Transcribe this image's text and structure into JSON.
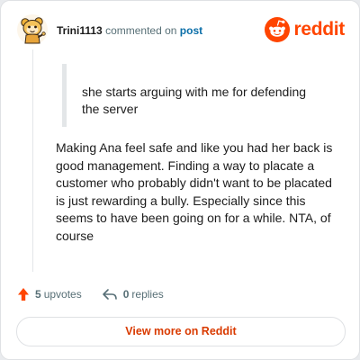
{
  "header": {
    "username": "Trini1113",
    "action_text": "commented on",
    "post_link": "post",
    "brand_name": "reddit"
  },
  "comment": {
    "quote": "she starts arguing with me for defending the server",
    "body": "Making Ana feel safe and like you had her back is good management. Finding a way to placate a customer who probably didn't want to be placated is just rewarding a bully. Especially since this seems to have been going on for a while. NTA, of course"
  },
  "stats": {
    "upvotes_count": "5",
    "upvotes_word": "upvotes",
    "replies_count": "0",
    "replies_word": "replies"
  },
  "button": {
    "label": "View more on Reddit"
  },
  "icons": {
    "avatar": "snoo-avatar-icon",
    "brand": "reddit-logo-icon",
    "upvote": "upvote-arrow-icon",
    "reply": "reply-arrow-icon"
  },
  "colors": {
    "brand": "#ff4500",
    "link": "#0a6ea8",
    "button_text": "#d93a00",
    "meta_text": "#576f76",
    "upvote": "#ff4500"
  }
}
